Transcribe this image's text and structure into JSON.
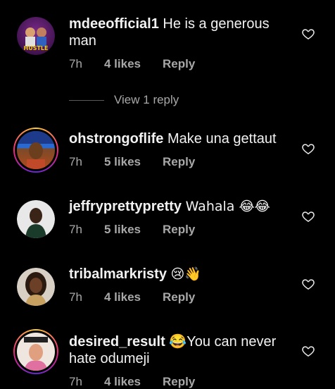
{
  "comments": [
    {
      "username": "mdeeofficial1",
      "text": "He is a generous man",
      "time": "7h",
      "likes": "4 likes",
      "reply": "Reply"
    },
    {
      "username": "ohstrongoflife",
      "text": "Make una gettaut",
      "time": "7h",
      "likes": "5 likes",
      "reply": "Reply"
    },
    {
      "username": "jeffryprettypretty",
      "text": "Wahala 😂😂",
      "time": "7h",
      "likes": "5 likes",
      "reply": "Reply"
    },
    {
      "username": "tribalmarkristy",
      "text": "😢👋",
      "time": "7h",
      "likes": "4 likes",
      "reply": "Reply"
    },
    {
      "username": "desired_result",
      "text": "😂You can never hate odumeji",
      "time": "7h",
      "likes": "4 likes",
      "reply": "Reply"
    }
  ],
  "view_replies": "View 1 reply",
  "avatar_text": {
    "mdee": "HUSTLE"
  },
  "icons": {
    "like": "heart-outline-icon"
  },
  "colors": {
    "background": "#000000",
    "secondary_text": "#a8a8a8",
    "story_ring": "#ee2a7b"
  }
}
